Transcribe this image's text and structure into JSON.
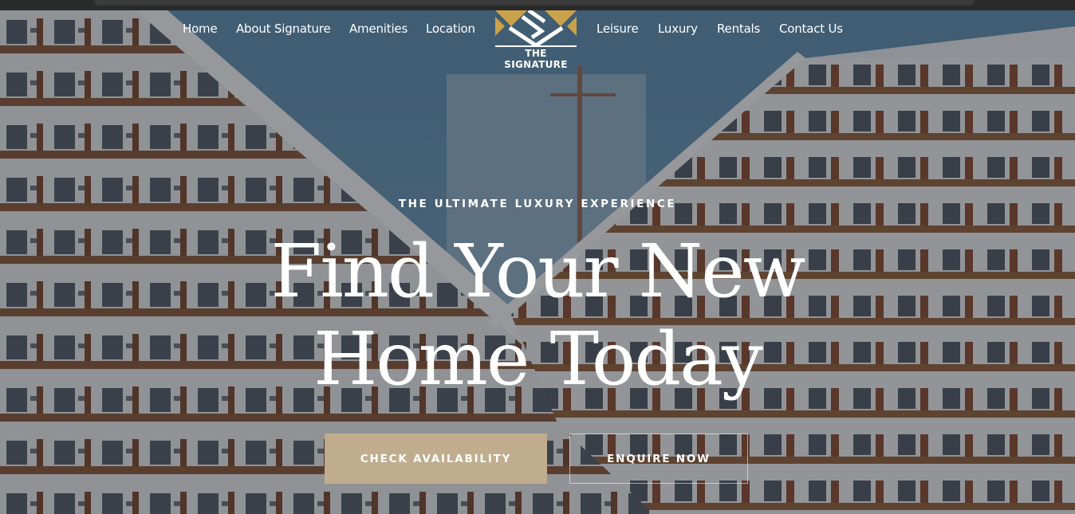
{
  "nav": {
    "items": [
      {
        "label": "Home"
      },
      {
        "label": "About Signature"
      },
      {
        "label": "Amenities"
      },
      {
        "label": "Location"
      },
      {
        "label": "Leisure"
      },
      {
        "label": "Luxury"
      },
      {
        "label": "Rentals"
      },
      {
        "label": "Contact Us"
      }
    ]
  },
  "logo": {
    "name": "THE SIGNATURE",
    "icon": "diamond-s-logo-icon"
  },
  "hero": {
    "eyebrow": "THE ULTIMATE LUXURY EXPERIENCE",
    "headline_line1": "Find Your New",
    "headline_line2": "Home Today",
    "primary_cta": "CHECK AVAILABILITY",
    "secondary_cta": "ENQUIRE NOW"
  },
  "colors": {
    "accent": "#bfad8e",
    "logo_gold": "#c9a24b",
    "text": "#ffffff"
  }
}
